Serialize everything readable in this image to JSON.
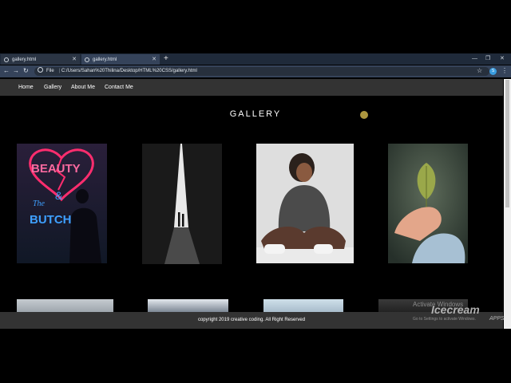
{
  "browser": {
    "tabs": [
      {
        "title": "gallery.html"
      },
      {
        "title": "gallery.html"
      }
    ],
    "new_tab": "+",
    "address": {
      "scheme": "File",
      "url": "C:/Users/Sahan%20Thilina/Desktop/HTML%20CSS/gallery.html"
    },
    "avatar_letter": "S"
  },
  "nav": {
    "items": [
      {
        "label": "Home"
      },
      {
        "label": "Gallery"
      },
      {
        "label": "About Me"
      },
      {
        "label": "Contact Me"
      }
    ]
  },
  "main": {
    "title": "GALLERY",
    "photo_sign_text": {
      "line1": "BEAUTY",
      "line2": "&",
      "line3": "The",
      "line4": "BUTCH"
    }
  },
  "footer": {
    "text": "copyright 2019 creative coding. All Right Reserved"
  },
  "overlay": {
    "activate_line1": "Activate Windows",
    "activate_line2": "Go to Settings to activate Windows.",
    "recorder_brand": "Icecream",
    "recorder_suffix": "APPS"
  },
  "colors": {
    "navbar": "#333333",
    "page_bg": "#000000",
    "chrome_tab_active": "#35435a",
    "neon_pink": "#ff2d6e",
    "neon_blue": "#3ea0ff"
  }
}
